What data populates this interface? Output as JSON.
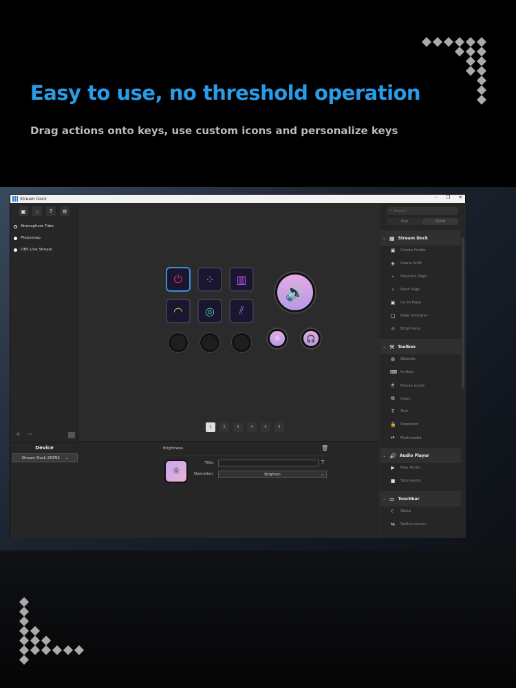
{
  "headline": "Easy to use, no threshold operation",
  "subline": "Drag actions onto keys, use custom icons and personalize keys",
  "app": {
    "title": "Stream Dock",
    "window_controls": [
      "–",
      "❐",
      "✕"
    ]
  },
  "toolbar": [
    {
      "icon": "cube-icon",
      "glyph": "▣"
    },
    {
      "icon": "home-icon",
      "glyph": "⌂"
    },
    {
      "icon": "help-icon",
      "glyph": "?"
    },
    {
      "icon": "gear-icon",
      "glyph": "⚙"
    }
  ],
  "profiles": [
    {
      "label": "Atmosphere Tube",
      "selected": true
    },
    {
      "label": "Photoshop",
      "selected": false
    },
    {
      "label": "OBS Live Stream",
      "selected": false
    }
  ],
  "device": {
    "label": "Device",
    "selected": "Stream Dock 293N3"
  },
  "left_controls": {
    "add": "+",
    "remove": "−"
  },
  "keys": [
    "⏻",
    "⁘",
    "▥",
    "◠",
    "◎",
    "⫽"
  ],
  "dial_icon": "🔊",
  "small_knobs": [
    "☼",
    "🎧"
  ],
  "pages": [
    "1",
    "2",
    "3",
    "4",
    "5",
    "6"
  ],
  "active_page": "1",
  "property": {
    "name": "Brightness",
    "title_label": "Title:",
    "title_value": "",
    "operation_label": "Operation:",
    "operation_value": "Brighten"
  },
  "search": {
    "placeholder": "Search"
  },
  "tabs": [
    "Key",
    "Knob"
  ],
  "categories": [
    {
      "name": "Stream Dock",
      "icon": "▦",
      "items": [
        [
          "▣",
          "Create Folder"
        ],
        [
          "◈",
          "Scene Shift"
        ],
        [
          "‹",
          "Previous Page"
        ],
        [
          "›",
          "Next Page"
        ],
        [
          "▣",
          "Go to Page"
        ],
        [
          "□",
          "Page Indicator"
        ],
        [
          "☼",
          "Brightness"
        ]
      ]
    },
    {
      "name": "Toolbox",
      "icon": "⚒",
      "items": [
        [
          "◍",
          "Website"
        ],
        [
          "⌨",
          "Hotkey"
        ],
        [
          "🖱",
          "Mouse event"
        ],
        [
          "⧉",
          "Open"
        ],
        [
          "T",
          "Text"
        ],
        [
          "🔒",
          "Password"
        ],
        [
          "⏯",
          "Multimedia"
        ]
      ]
    },
    {
      "name": "Audio Player",
      "icon": "🔊",
      "items": [
        [
          "▶",
          "Play Audio"
        ],
        [
          "■",
          "Stop Audio"
        ]
      ]
    },
    {
      "name": "Touchbar",
      "icon": "▭",
      "items": [
        [
          "☾",
          "Sleep"
        ],
        [
          "⇆",
          "Switch screen"
        ]
      ]
    }
  ],
  "colors": {
    "accent": "#2a9be8",
    "key_gradient": "#e6a9e3"
  }
}
